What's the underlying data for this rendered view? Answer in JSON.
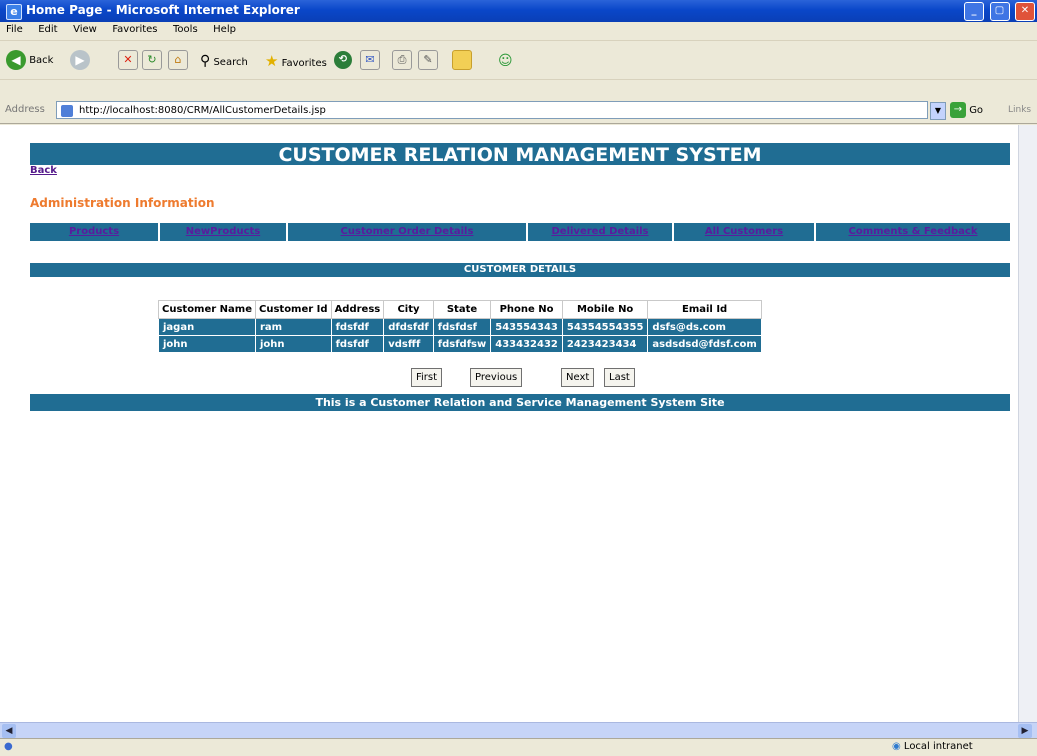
{
  "window": {
    "title": "Home Page - Microsoft Internet Explorer",
    "buttons": [
      "_",
      "▢",
      "✕"
    ]
  },
  "menu": [
    "File",
    "Edit",
    "View",
    "Favorites",
    "Tools",
    "Help"
  ],
  "toolbar": {
    "back": "Back",
    "search": "Search",
    "favorites": "Favorites"
  },
  "address": {
    "label": "Address",
    "url": "http://localhost:8080/CRM/AllCustomerDetails.jsp",
    "go": "Go",
    "links": "Links"
  },
  "page": {
    "header": "CUSTOMER RELATION MANAGEMENT SYSTEM",
    "back": "Back",
    "section": "Administration Information",
    "nav": [
      "Products",
      "NewProducts",
      "Customer Order Details",
      "Delivered Details",
      "All Customers",
      "Comments & Feedback"
    ],
    "details_title": "CUSTOMER DETAILS",
    "table": {
      "headers": [
        "Customer Name",
        "Customer Id",
        "Address",
        "City",
        "State",
        "Phone No",
        "Mobile No",
        "Email Id"
      ],
      "rows": [
        [
          "jagan",
          "ram",
          "fdsfdf",
          "dfdsfdf",
          "fdsfdsf",
          "543554343",
          "54354554355",
          "dsfs@ds.com"
        ],
        [
          "john",
          "john",
          "fdsfdf",
          "vdsfff",
          "fdsfdfsw",
          "433432432",
          "2423423434",
          "asdsdsd@fdsf.com"
        ]
      ]
    },
    "pager": [
      "First",
      "Previous",
      "Next",
      "Last"
    ],
    "footer": "This is a Customer Relation and Service Management System Site"
  },
  "status": {
    "zone": "Local intranet"
  }
}
